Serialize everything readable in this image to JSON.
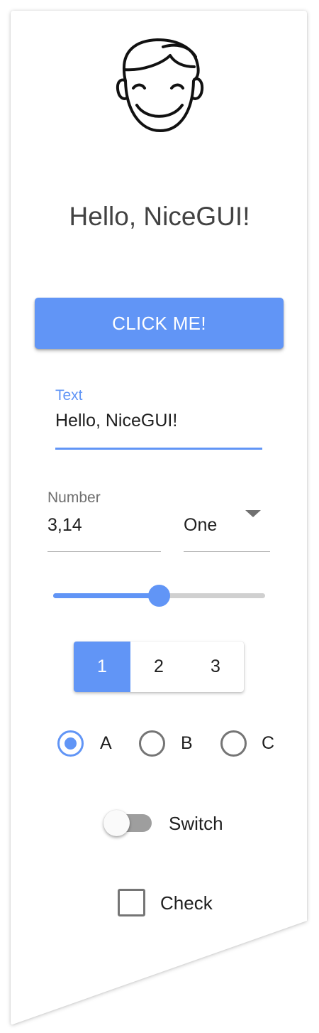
{
  "avatar": {
    "icon": "smiling-face-avatar-icon"
  },
  "greeting": "Hello, NiceGUI!",
  "button": {
    "label": "CLICK ME!",
    "color": "#6195f6"
  },
  "text_input": {
    "label": "Text",
    "value": "Hello, NiceGUI!"
  },
  "number_input": {
    "label": "Number",
    "value": "3,14"
  },
  "select": {
    "value": "One"
  },
  "slider": {
    "value_fraction": 0.5
  },
  "toggle": {
    "options": [
      "1",
      "2",
      "3"
    ],
    "selected": "1"
  },
  "radio": {
    "options": [
      "A",
      "B",
      "C"
    ],
    "selected": "A"
  },
  "switch": {
    "label": "Switch",
    "on": false
  },
  "checkbox": {
    "label": "Check",
    "checked": false
  }
}
